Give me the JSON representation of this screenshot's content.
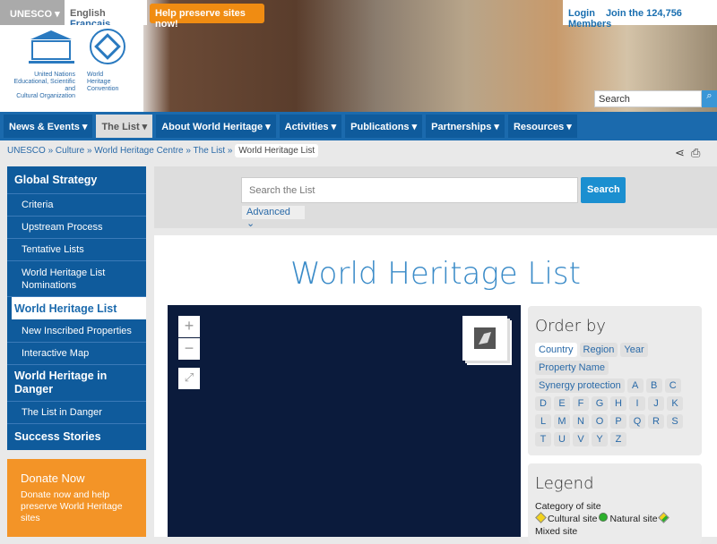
{
  "topbar": {
    "unesco": "UNESCO ▾",
    "english": "English",
    "francais": "Français",
    "help": "Help preserve sites now!",
    "login": "Login",
    "join": "Join the 124,756 Members"
  },
  "logo": {
    "un": "United Nations\nEducational, Scientific and\nCultural Organization",
    "whc": "World\nHeritage\nConvention",
    "text": "UNESCO"
  },
  "header_search": {
    "placeholder": "Search",
    "icon": "search-icon"
  },
  "nav": [
    "News & Events ▾",
    "The List ▾",
    "About World Heritage ▾",
    "Activities ▾",
    "Publications ▾",
    "Partnerships ▾",
    "Resources ▾"
  ],
  "breadcrumb": [
    "UNESCO",
    "Culture",
    "World Heritage Centre",
    "The List",
    "World Heritage List"
  ],
  "sidebar": [
    {
      "label": "Global Strategy",
      "type": "h"
    },
    {
      "label": "Criteria"
    },
    {
      "label": "Upstream Process"
    },
    {
      "label": "Tentative Lists"
    },
    {
      "label": "World Heritage List Nominations"
    },
    {
      "label": "World Heritage List",
      "type": "active"
    },
    {
      "label": "New Inscribed Properties"
    },
    {
      "label": "Interactive Map"
    },
    {
      "label": "World Heritage in Danger",
      "type": "h"
    },
    {
      "label": "The List in Danger"
    },
    {
      "label": "Success Stories",
      "type": "h"
    }
  ],
  "donate": {
    "title": "Donate Now",
    "text": "Donate now and help preserve World Heritage sites"
  },
  "list_search": {
    "placeholder": "Search the List",
    "button": "Search",
    "advanced": "Advanced ⌄"
  },
  "page_title": "World Heritage List",
  "map": {
    "zoom_in": "+",
    "zoom_out": "−",
    "fullscreen": "⤢"
  },
  "order_by": {
    "title": "Order by",
    "options": [
      "Country",
      "Region",
      "Year",
      "Property Name",
      "Synergy protection"
    ],
    "letters": [
      "A",
      "B",
      "C",
      "D",
      "E",
      "F",
      "G",
      "H",
      "I",
      "J",
      "K",
      "L",
      "M",
      "N",
      "O",
      "P",
      "Q",
      "R",
      "S",
      "T",
      "U",
      "V",
      "Y",
      "Z"
    ]
  },
  "legend": {
    "title": "Legend",
    "category": "Category of site",
    "cultural": "Cultural site",
    "natural": "Natural site",
    "mixed": "Mixed site"
  },
  "colors": {
    "brand": "#1b6aad",
    "orange": "#f08c12",
    "map": "#0b1b3c"
  }
}
